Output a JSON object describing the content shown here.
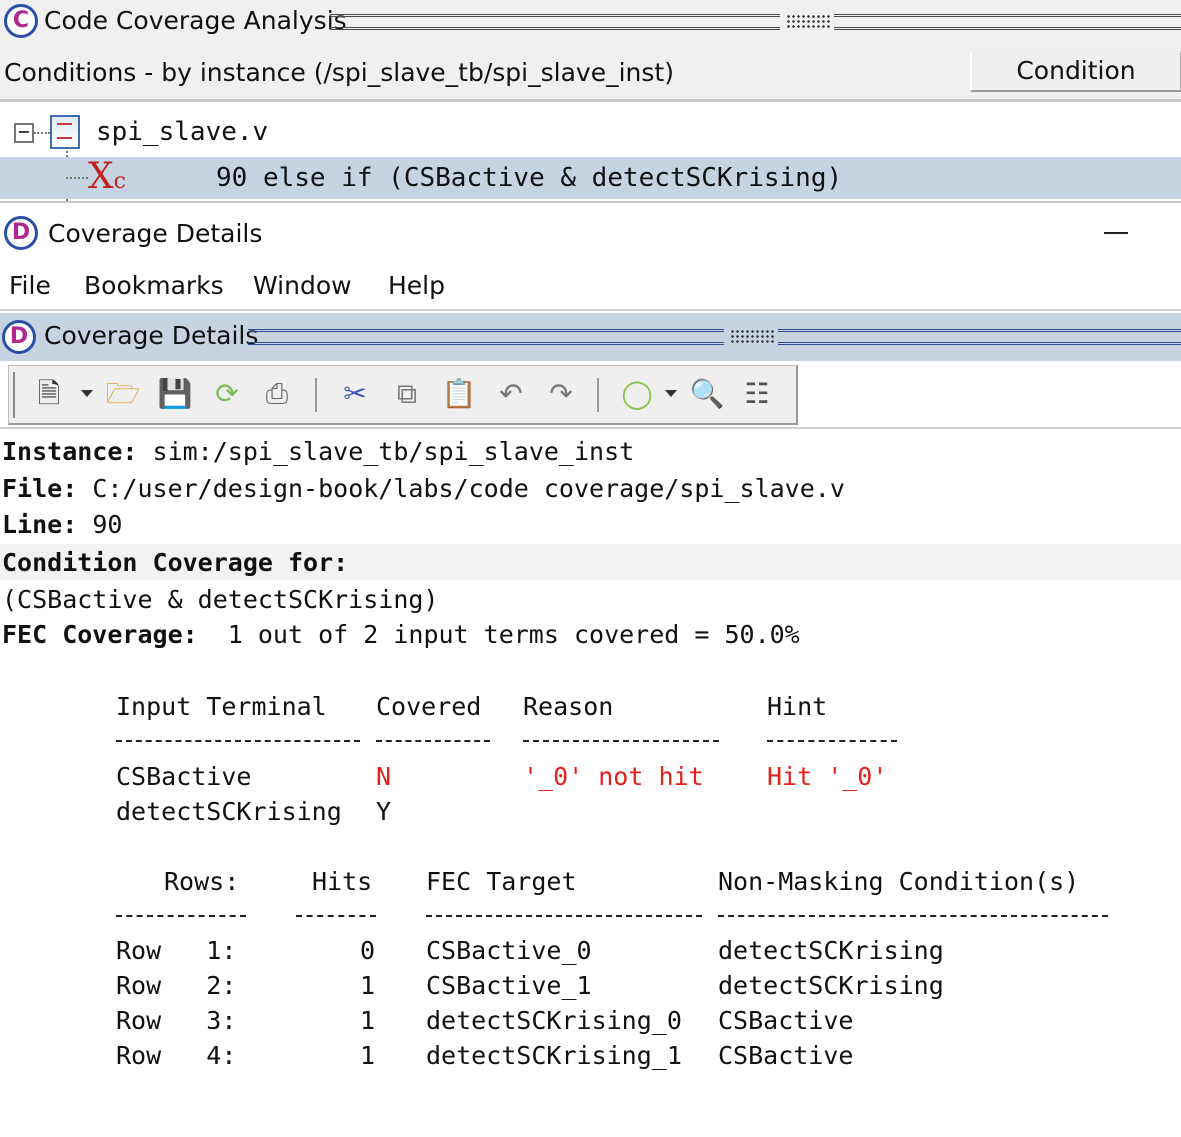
{
  "code_coverage": {
    "logo_letter": "C",
    "title": "Code Coverage Analysis",
    "subtitle": "Conditions - by instance (/spi_slave_tb/spi_slave_inst)",
    "column_header": "Condition",
    "toggle_symbol": "−",
    "tree": {
      "file": "spi_slave.v",
      "status_icon": "X",
      "status_icon_sub": "c",
      "row_text": "90 else if (CSBactive & detectSCKrising)"
    }
  },
  "coverage_details": {
    "logo_letter": "D",
    "window_title": "Coverage Details",
    "panel_title": "Coverage Details",
    "menu": [
      "File",
      "Bookmarks",
      "Window",
      "Help"
    ],
    "toolbar_icons": [
      "new-document-icon",
      "open-folder-icon",
      "save-icon",
      "reload-icon",
      "print-icon",
      "cut-icon",
      "copy-icon",
      "paste-icon",
      "undo-icon",
      "redo-icon",
      "run-icon",
      "find-icon",
      "structure-icon"
    ],
    "instance_label": "Instance:",
    "instance_value": "sim:/spi_slave_tb/spi_slave_inst",
    "file_label": "File:",
    "file_value": "C:/user/design-book/labs/code coverage/spi_slave.v",
    "line_label": "Line:",
    "line_value": "90",
    "cond_for_label": "Condition Coverage for:",
    "expression": "(CSBactive & detectSCKrising)",
    "fec_label": "FEC Coverage:",
    "fec_value": "1 out of 2 input terms covered = 50.0%",
    "terms_table": {
      "headers": [
        "Input Terminal",
        "Covered",
        "Reason",
        "Hint"
      ],
      "rows": [
        {
          "terminal": "CSBactive",
          "covered": "N",
          "reason": "'_0' not hit",
          "hint": "Hit '_0'"
        },
        {
          "terminal": "detectSCKrising",
          "covered": "Y",
          "reason": "",
          "hint": ""
        }
      ]
    },
    "rows_table": {
      "headers": [
        "Rows:",
        "Hits",
        "FEC Target",
        "Non-Masking Condition(s)"
      ],
      "rows": [
        {
          "row": "Row   1:",
          "hits": "0",
          "target": "CSBactive_0",
          "condition": "detectSCKrising"
        },
        {
          "row": "Row   2:",
          "hits": "1",
          "target": "CSBactive_1",
          "condition": "detectSCKrising"
        },
        {
          "row": "Row   3:",
          "hits": "1",
          "target": "detectSCKrising_0",
          "condition": "CSBactive"
        },
        {
          "row": "Row   4:",
          "hits": "1",
          "target": "detectSCKrising_1",
          "condition": "CSBactive"
        }
      ]
    }
  },
  "colors": {
    "selection": "#c6d3e3",
    "miss": "#e2201c",
    "logo_ring": "#2a4fa8",
    "logo_letter": "#b0258f"
  }
}
